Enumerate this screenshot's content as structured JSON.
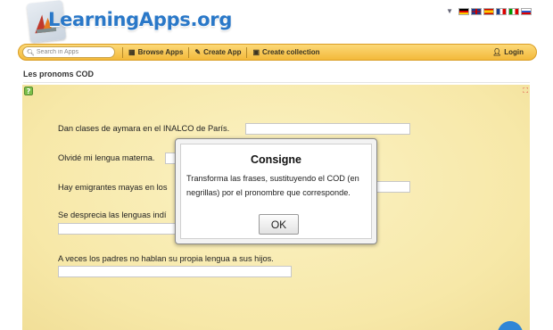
{
  "header": {
    "logo_text": "LearningApps.org",
    "languages": [
      "de",
      "gb",
      "es",
      "fr",
      "it",
      "ru"
    ]
  },
  "toolbar": {
    "search_placeholder": "Search in Apps",
    "browse_label": "Browse Apps",
    "create_label": "Create App",
    "collection_label": "Create collection",
    "login_label": "Login"
  },
  "page": {
    "title": "Les pronoms COD"
  },
  "exercise": {
    "sentences": [
      "Dan clases de aymara en el INALCO de París.",
      "Olvidé mi lengua materna.",
      "Hay emigrantes mayas en los",
      "Se desprecia las lenguas indí",
      "A veces los padres no hablan su propia lengua a sus hijos."
    ]
  },
  "dialog": {
    "title": "Consigne",
    "body": "Transforma las frases, sustituyendo el COD (en negrillas) por el pronombre que corresponde.",
    "ok_label": "OK"
  }
}
